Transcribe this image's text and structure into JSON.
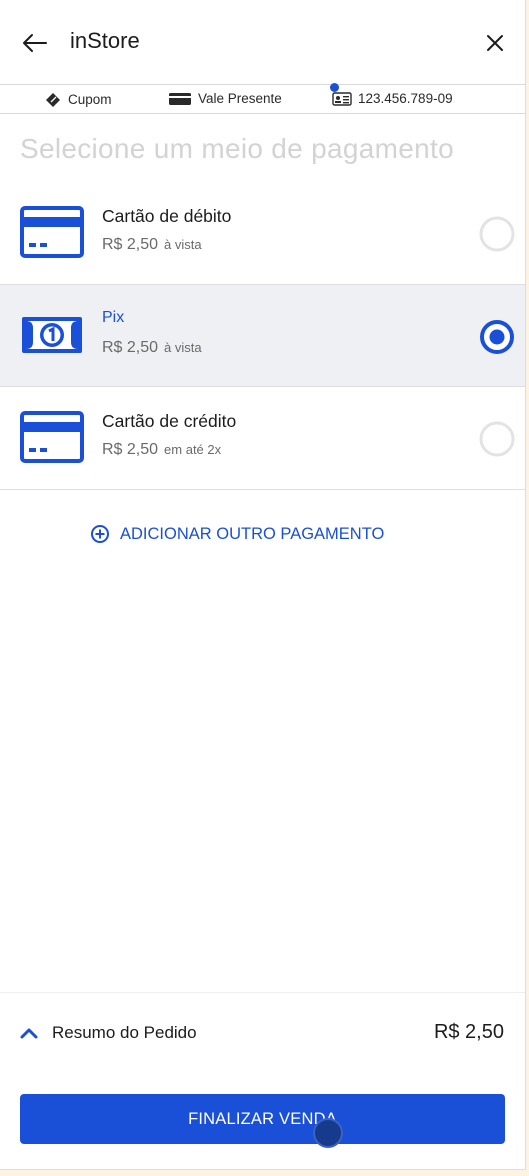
{
  "header": {
    "title": "inStore"
  },
  "infobar": {
    "coupon_label": "Cupom",
    "gift_label": "Vale Presente",
    "cpf_value": "123.456.789-09"
  },
  "section_title": "Selecione um meio de pagamento",
  "payment_options": [
    {
      "name": "Cartão de débito",
      "price": "R$ 2,50",
      "note": "à vista",
      "icon": "card-icon",
      "selected": false
    },
    {
      "name": "Pix",
      "price": "R$ 2,50",
      "note": "à vista",
      "icon": "banknote-icon",
      "selected": true
    },
    {
      "name": "Cartão de crédito",
      "price": "R$ 2,50",
      "note": "em até 2x",
      "icon": "card-icon",
      "selected": false
    }
  ],
  "add_payment_label": "ADICIONAR OUTRO PAGAMENTO",
  "summary": {
    "label": "Resumo do Pedido",
    "total": "R$ 2,50"
  },
  "finish_button_label": "FINALIZAR VENDA",
  "colors": {
    "accent": "#1a4fd8",
    "selected_bg": "#eef0f3",
    "muted_text": "#d3d3d3"
  }
}
